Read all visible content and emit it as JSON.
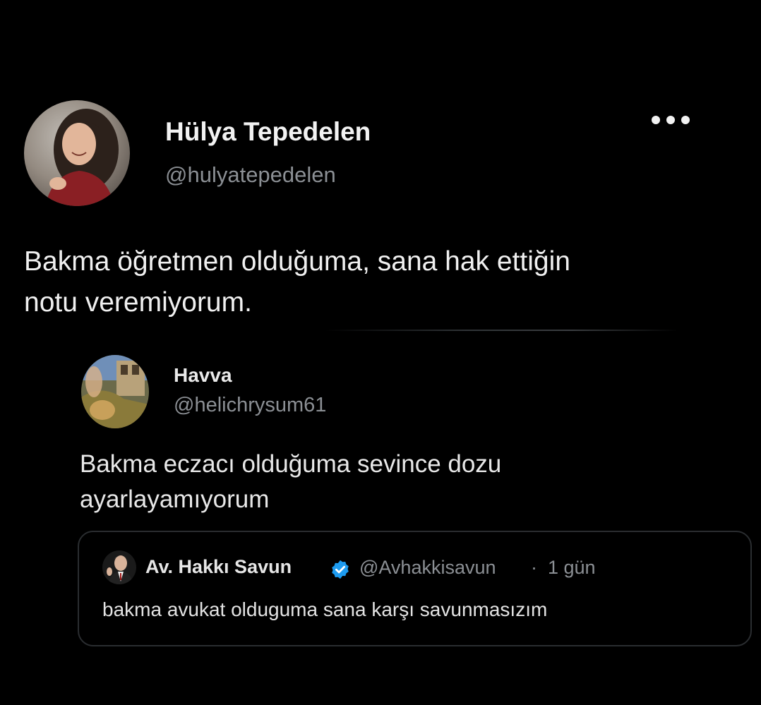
{
  "main_tweet": {
    "author": {
      "display_name": "Hülya Tepedelen",
      "handle": "@hulyatepedelen",
      "avatar_icon": "profile-photo"
    },
    "more_icon": "more-horizontal-icon",
    "text_line_1": "Bakma öğretmen olduğuma, sana hak ettiğin",
    "text_line_2": "notu veremiyorum."
  },
  "quoted_tweet": {
    "author": {
      "display_name": "Havva",
      "handle": "@helichrysum61",
      "avatar_icon": "profile-photo"
    },
    "text_line_1": "Bakma eczacı olduğuma sevince dozu",
    "text_line_2": "ayarlayamıyorum",
    "nested_quote": {
      "author": {
        "display_name": "Av. Hakkı Savun",
        "verified": true,
        "verified_icon": "verified-badge-icon",
        "handle": "@Avhakkisavun",
        "separator": "·",
        "time": "1 gün",
        "avatar_icon": "profile-photo"
      },
      "text": "bakma avukat olduguma sana karşı savunmasızım"
    }
  },
  "colors": {
    "background": "#000000",
    "primary_text": "#e7e9ea",
    "secondary_text": "#8b8f94",
    "verified_blue": "#1d9bf0",
    "card_border": "#2a2d30"
  }
}
